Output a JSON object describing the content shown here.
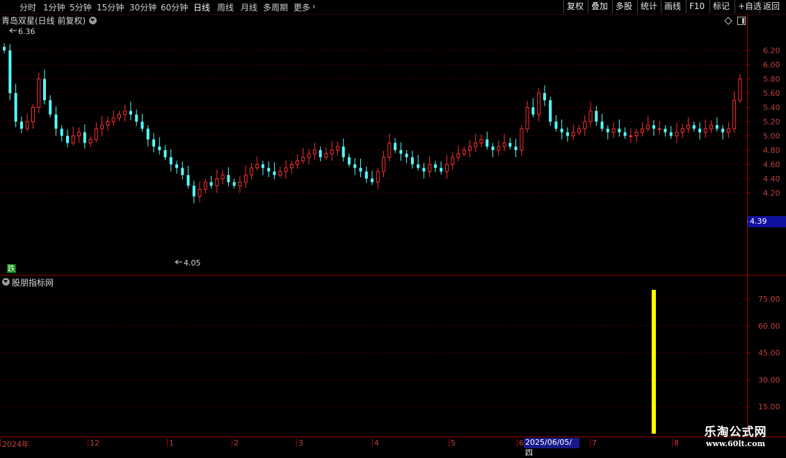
{
  "toolbar": {
    "periods": [
      "分时",
      "1分钟",
      "5分钟",
      "15分钟",
      "30分钟",
      "60分钟",
      "日线",
      "周线",
      "月线",
      "多周期",
      "更多"
    ],
    "active_period": "日线",
    "right_buttons": [
      "复权",
      "叠加",
      "多股",
      "统计",
      "画线",
      "F10",
      "标记",
      "+自选",
      "返回"
    ]
  },
  "main_pane": {
    "title": "青岛双星(日线 前复权)",
    "high_marker": "6.36",
    "low_marker": "4.05",
    "badge": "跌",
    "current_price": "4.39",
    "yaxis_ticks": [
      "6.20",
      "6.00",
      "5.80",
      "5.60",
      "5.40",
      "5.20",
      "5.00",
      "4.80",
      "4.60",
      "4.40",
      "4.20"
    ]
  },
  "indicator_pane": {
    "title": "股朋指标网",
    "yaxis_ticks": [
      "75.00",
      "60.00",
      "45.00",
      "30.00",
      "15.00"
    ]
  },
  "date_axis": {
    "labels": [
      "2024年",
      "12",
      "1",
      "2",
      "3",
      "4",
      "5",
      "6",
      "7",
      "8"
    ],
    "cursor_date": "2025/06/05/四"
  },
  "watermark": {
    "line1": "乐淘公式网",
    "line2": "www.60lt.com"
  },
  "colors": {
    "up": "#ff3030",
    "down": "#54ffff",
    "grid": "#7a0000",
    "signal": "#ffff00",
    "price_box": "#1010a0"
  },
  "icons": [
    "chevron-down-icon",
    "diamond-icon",
    "panel-toggle-icon",
    "arrow-right-icon"
  ],
  "chart_data": [
    {
      "type": "candlestick",
      "title": "青岛双星(日线 前复权)",
      "y_ticks": [
        4.2,
        4.4,
        4.6,
        4.8,
        5.0,
        5.2,
        5.4,
        5.6,
        5.8,
        6.0,
        6.2
      ],
      "ylim": [
        4.0,
        6.4
      ],
      "high": 6.36,
      "low": 4.05,
      "last": 4.39,
      "closes": [
        6.2,
        5.6,
        5.2,
        5.1,
        5.2,
        5.4,
        5.8,
        5.5,
        5.3,
        5.1,
        5.0,
        4.9,
        5.0,
        5.05,
        4.9,
        4.95,
        5.1,
        5.15,
        5.2,
        5.25,
        5.3,
        5.35,
        5.3,
        5.2,
        5.1,
        4.95,
        4.85,
        4.8,
        4.7,
        4.6,
        4.55,
        4.45,
        4.3,
        4.15,
        4.25,
        4.35,
        4.3,
        4.4,
        4.45,
        4.35,
        4.3,
        4.35,
        4.45,
        4.55,
        4.6,
        4.55,
        4.5,
        4.45,
        4.5,
        4.55,
        4.6,
        4.65,
        4.7,
        4.75,
        4.8,
        4.7,
        4.75,
        4.8,
        4.85,
        4.7,
        4.6,
        4.55,
        4.5,
        4.4,
        4.35,
        4.5,
        4.7,
        4.9,
        4.8,
        4.75,
        4.7,
        4.6,
        4.55,
        4.5,
        4.6,
        4.55,
        4.5,
        4.6,
        4.7,
        4.75,
        4.8,
        4.85,
        4.9,
        4.95,
        4.85,
        4.8,
        4.85,
        4.9,
        4.85,
        4.8,
        5.1,
        5.4,
        5.3,
        5.6,
        5.5,
        5.2,
        5.1,
        5.05,
        5.0,
        5.05,
        5.1,
        5.2,
        5.35,
        5.2,
        5.1,
        5.05,
        5.1,
        5.05,
        5.0,
        5.0,
        5.05,
        5.1,
        5.15,
        5.1,
        5.1,
        5.05,
        5.0,
        5.05,
        5.1,
        5.15,
        5.1,
        5.05,
        5.1,
        5.15,
        5.1,
        5.05,
        5.1,
        5.5,
        5.8
      ]
    },
    {
      "type": "bar",
      "title": "股朋指标网",
      "y_ticks": [
        15,
        30,
        45,
        60,
        75
      ],
      "ylim": [
        0,
        85
      ],
      "signal_index": 113,
      "signal_value": 80
    }
  ]
}
